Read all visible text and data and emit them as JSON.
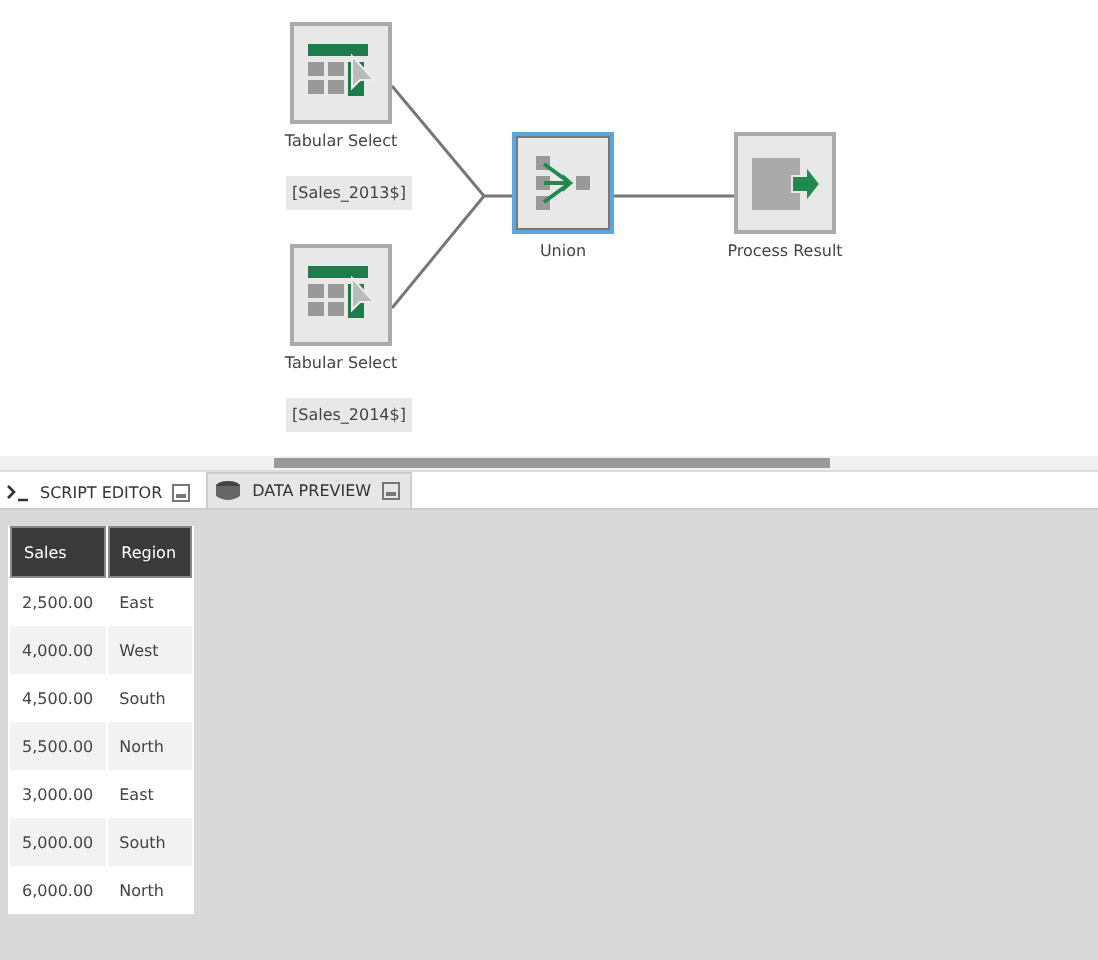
{
  "canvas": {
    "nodes": [
      {
        "kind": "select",
        "label": "Tabular Select",
        "tag": "[Sales_2013$]",
        "selected": false
      },
      {
        "kind": "select",
        "label": "Tabular Select",
        "tag": "[Sales_2014$]",
        "selected": false
      },
      {
        "kind": "union",
        "label": "Union",
        "selected": true
      },
      {
        "kind": "result",
        "label": "Process Result",
        "selected": false
      }
    ]
  },
  "tabs": [
    {
      "kind": "script",
      "label": "SCRIPT EDITOR",
      "selected": false
    },
    {
      "kind": "preview",
      "label": "DATA PREVIEW",
      "selected": true
    }
  ],
  "table": {
    "columns": [
      "Sales",
      "Region"
    ],
    "rows": [
      [
        "2,500.00",
        "East"
      ],
      [
        "4,000.00",
        "West"
      ],
      [
        "4,500.00",
        "South"
      ],
      [
        "5,500.00",
        "North"
      ],
      [
        "3,000.00",
        "East"
      ],
      [
        "5,000.00",
        "South"
      ],
      [
        "6,000.00",
        "North"
      ]
    ]
  }
}
